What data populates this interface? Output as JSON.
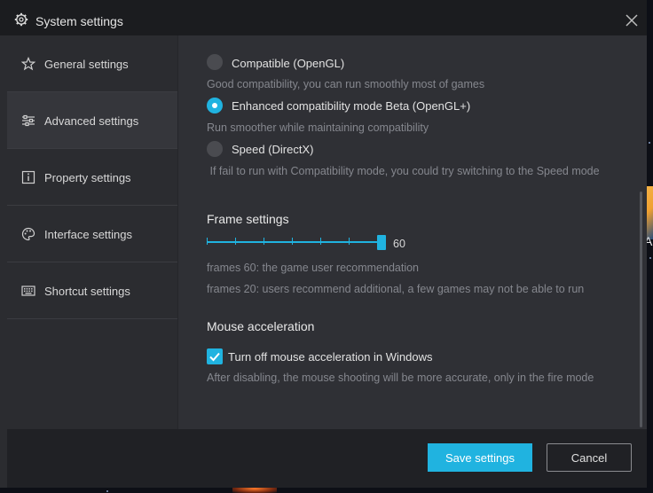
{
  "window": {
    "title": "System settings",
    "icon": "gear-icon",
    "close_icon": "close-icon"
  },
  "sidebar": {
    "items": [
      {
        "label": "General settings",
        "icon": "star-icon",
        "active": false
      },
      {
        "label": "Advanced settings",
        "icon": "sliders-icon",
        "active": true
      },
      {
        "label": "Property settings",
        "icon": "info-icon",
        "active": false
      },
      {
        "label": "Interface settings",
        "icon": "palette-icon",
        "active": false
      },
      {
        "label": "Shortcut settings",
        "icon": "keyboard-icon",
        "active": false
      }
    ]
  },
  "render_mode": {
    "options": [
      {
        "label": "Compatible (OpenGL)",
        "hint": "Good compatibility, you can run smoothly most of games",
        "selected": false
      },
      {
        "label": "Enhanced compatibility mode Beta (OpenGL+)",
        "hint": "Run smoother while maintaining compatibility",
        "selected": true
      },
      {
        "label": "Speed (DirectX)",
        "hint": " If fail to run with Compatibility mode, you could try switching to the Speed mode",
        "selected": false
      }
    ]
  },
  "frame": {
    "title": "Frame settings",
    "value": "60",
    "level": 1.0,
    "hints": [
      "frames 60: the game user recommendation",
      "frames 20: users recommend additional, a few games may not be able to run"
    ]
  },
  "mouse": {
    "title": "Mouse acceleration",
    "checkbox_label": "Turn off mouse acceleration in Windows",
    "checked": true,
    "hint": "After disabling, the mouse shooting will be more accurate, only in the fire mode"
  },
  "footer": {
    "save_label": "Save settings",
    "cancel_label": "Cancel"
  },
  "colors": {
    "accent": "#20b3e0",
    "panel": "#2f3035",
    "titlebar": "#1b1c1f",
    "footer": "#202125"
  },
  "background_app": {
    "label": "Ap"
  }
}
